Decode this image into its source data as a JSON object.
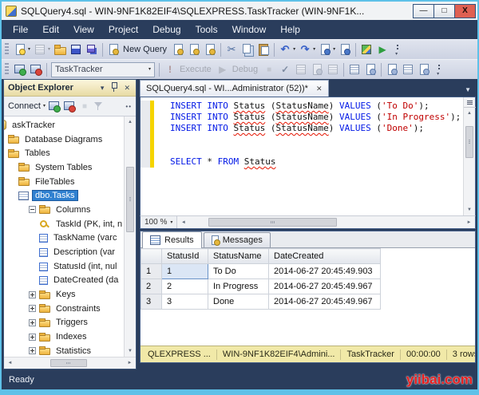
{
  "window": {
    "title": "SQLQuery4.sql - WIN-9NF1K82EIF4\\SQLEXPRESS.TaskTracker (WIN-9NF1K...",
    "controls": [
      {
        "name": "minimize",
        "glyph": "—"
      },
      {
        "name": "maximize",
        "glyph": "□"
      },
      {
        "name": "close",
        "glyph": "X"
      }
    ]
  },
  "menu": {
    "items": [
      "File",
      "Edit",
      "View",
      "Project",
      "Debug",
      "Tools",
      "Window",
      "Help"
    ]
  },
  "toolbar_standard": {
    "buttons": [
      {
        "name": "new-item",
        "icon": "doc-new",
        "caret": true
      },
      {
        "name": "add-item",
        "icon": "grid",
        "caret": true,
        "disabled": true
      },
      {
        "name": "open-file",
        "icon": "folder-open"
      },
      {
        "name": "save",
        "icon": "floppy"
      },
      {
        "name": "save-all",
        "icon": "floppy-all"
      },
      {
        "sep": true
      },
      {
        "name": "new-query",
        "icon": "doc-db",
        "label": "New Query"
      },
      {
        "name": "database-engine-query",
        "icon": "doc-db"
      },
      {
        "name": "analysis-services-query",
        "icon": "doc-db"
      },
      {
        "name": "mdx-query",
        "icon": "doc-db"
      },
      {
        "sep": true
      },
      {
        "name": "cut",
        "icon": "scissors"
      },
      {
        "name": "copy",
        "icon": "copy"
      },
      {
        "name": "paste",
        "icon": "paste"
      },
      {
        "sep": true
      },
      {
        "name": "undo",
        "icon": "undo",
        "caret": true
      },
      {
        "name": "redo",
        "icon": "redo",
        "caret": true
      },
      {
        "name": "navigate-backward",
        "icon": "doc-arrow",
        "caret": true
      },
      {
        "name": "navigate-forward",
        "icon": "doc-arrow2"
      },
      {
        "sep": true
      },
      {
        "name": "activity-monitor",
        "icon": "activity"
      },
      {
        "name": "start",
        "icon": "play-green"
      },
      {
        "name": "toolbar-overflow",
        "icon": "overflow"
      }
    ]
  },
  "toolbar_sql": {
    "buttons": [
      {
        "name": "connect",
        "icon": "server-connect"
      },
      {
        "name": "disconnect",
        "icon": "server-disconnect"
      },
      {
        "sep": true
      },
      {
        "name": "available-databases",
        "combo": "TaskTracker"
      },
      {
        "sep": true
      },
      {
        "name": "execute",
        "icon": "bang",
        "label": "Execute",
        "disabled": true
      },
      {
        "name": "debug",
        "icon": "play-gray",
        "label": "Debug",
        "disabled": true
      },
      {
        "name": "stop",
        "icon": "stop",
        "disabled": true
      },
      {
        "name": "parse",
        "icon": "check"
      },
      {
        "name": "display-estimated-plan",
        "icon": "grid2",
        "disabled": true
      },
      {
        "name": "query-options",
        "icon": "doc-sm",
        "disabled": true
      },
      {
        "name": "intellisense-enabled",
        "icon": "grid3",
        "disabled": true
      },
      {
        "sep": true
      },
      {
        "name": "include-actual-plan",
        "icon": "grid-q"
      },
      {
        "name": "include-client-statistics",
        "icon": "doc-q"
      },
      {
        "sep": true
      },
      {
        "name": "results-to-text",
        "icon": "doc-q"
      },
      {
        "name": "results-to-grid",
        "icon": "grid-q"
      },
      {
        "name": "results-to-file",
        "icon": "doc-q"
      },
      {
        "name": "toolbar-overflow",
        "icon": "overflow"
      }
    ]
  },
  "object_explorer": {
    "title": "Object Explorer",
    "connect_label": "Connect",
    "tree": [
      {
        "level": 0,
        "icon": "database",
        "label": "askTracker"
      },
      {
        "level": 1,
        "icon": "folder",
        "label": "Database Diagrams"
      },
      {
        "level": 1,
        "icon": "folder",
        "label": "Tables"
      },
      {
        "level": 2,
        "icon": "folder",
        "label": "System Tables"
      },
      {
        "level": 2,
        "icon": "folder",
        "label": "FileTables"
      },
      {
        "level": 2,
        "icon": "table",
        "label": "dbo.Tasks",
        "selected": true
      },
      {
        "level": 3,
        "expander": "minus",
        "icon": "folder",
        "label": "Columns"
      },
      {
        "level": 4,
        "icon": "key",
        "label": "TaskId (PK, int, n"
      },
      {
        "level": 4,
        "icon": "column",
        "label": "TaskName (varc"
      },
      {
        "level": 4,
        "icon": "column",
        "label": "Description (var"
      },
      {
        "level": 4,
        "icon": "column",
        "label": "StatusId (int, nul"
      },
      {
        "level": 4,
        "icon": "column",
        "label": "DateCreated (da"
      },
      {
        "level": 3,
        "expander": "plus",
        "icon": "folder",
        "label": "Keys"
      },
      {
        "level": 3,
        "expander": "plus",
        "icon": "folder",
        "label": "Constraints"
      },
      {
        "level": 3,
        "expander": "plus",
        "icon": "folder",
        "label": "Triggers"
      },
      {
        "level": 3,
        "expander": "plus",
        "icon": "folder",
        "label": "Indexes"
      },
      {
        "level": 3,
        "expander": "plus",
        "icon": "folder",
        "label": "Statistics"
      }
    ]
  },
  "editor": {
    "tab_title": "SQLQuery4.sql - WI...Administrator (52))*",
    "zoom": "100 %",
    "lines": [
      {
        "changed": true,
        "tokens": [
          [
            "kw",
            "INSERT INTO "
          ],
          [
            "err",
            "Status"
          ],
          [
            "pl",
            " ("
          ],
          [
            "err",
            "StatusName"
          ],
          [
            "pl",
            ") "
          ],
          [
            "kw",
            "VALUES"
          ],
          [
            "pl",
            " ("
          ],
          [
            "str",
            "'To Do'"
          ],
          [
            "pl",
            ");"
          ]
        ]
      },
      {
        "changed": true,
        "tokens": [
          [
            "kw",
            "INSERT INTO "
          ],
          [
            "err",
            "Status"
          ],
          [
            "pl",
            " ("
          ],
          [
            "err",
            "StatusName"
          ],
          [
            "pl",
            ") "
          ],
          [
            "kw",
            "VALUES"
          ],
          [
            "pl",
            " ("
          ],
          [
            "str",
            "'In Progress'"
          ],
          [
            "pl",
            ");"
          ]
        ]
      },
      {
        "changed": true,
        "tokens": [
          [
            "kw",
            "INSERT INTO "
          ],
          [
            "err",
            "Status"
          ],
          [
            "pl",
            " ("
          ],
          [
            "err",
            "StatusName"
          ],
          [
            "pl",
            ") "
          ],
          [
            "kw",
            "VALUES"
          ],
          [
            "pl",
            " ("
          ],
          [
            "str",
            "'Done'"
          ],
          [
            "pl",
            ");"
          ]
        ]
      },
      {
        "changed": true,
        "tokens": []
      },
      {
        "changed": true,
        "tokens": []
      },
      {
        "changed": true,
        "tokens": [
          [
            "kw",
            "SELECT"
          ],
          [
            "pl",
            " * "
          ],
          [
            "kw",
            "FROM"
          ],
          [
            "pl",
            " "
          ],
          [
            "err",
            "Status"
          ]
        ]
      }
    ]
  },
  "results": {
    "tabs": [
      "Results",
      "Messages"
    ],
    "grid": {
      "columns": [
        "StatusId",
        "StatusName",
        "DateCreated"
      ],
      "rows": [
        [
          "1",
          "To Do",
          "2014-06-27 20:45:49.903"
        ],
        [
          "2",
          "In Progress",
          "2014-06-27 20:45:49.967"
        ],
        [
          "3",
          "Done",
          "2014-06-27 20:45:49.967"
        ]
      ],
      "selected_cell": {
        "row": 0,
        "col": 0
      }
    },
    "status_segments": [
      "QLEXPRESS ...",
      "WIN-9NF1K82EIF4\\Admini...",
      "TaskTracker",
      "00:00:00",
      "3 rows"
    ]
  },
  "status_bar": {
    "text": "Ready"
  },
  "watermark": "yiibai.com",
  "colors": {
    "keyword_blue": "#0017e6",
    "string_red": "#c00000",
    "change_bar_yellow": "#f5d400",
    "selection_blue": "#2f80d0",
    "results_strip_khaki": "#f1e9a8",
    "chrome_navy": "#2a3d5c",
    "window_border_cyan": "#5ec1e8"
  }
}
